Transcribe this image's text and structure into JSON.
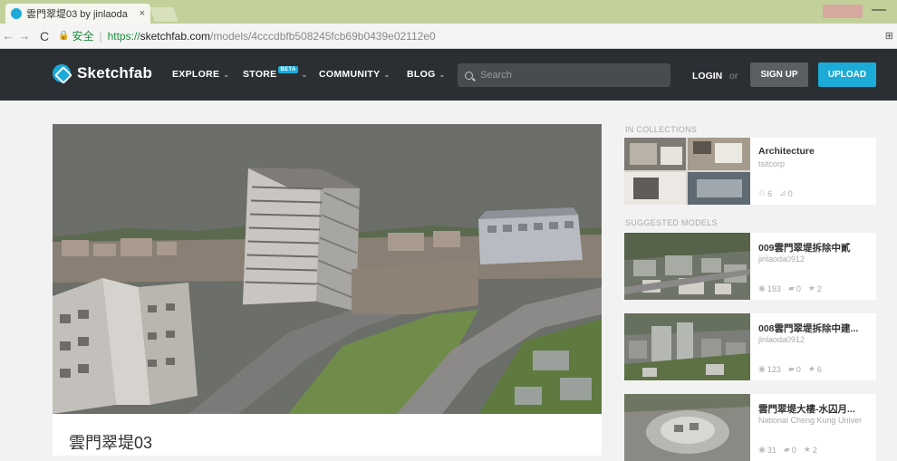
{
  "browser": {
    "tab_title": "雲門翠堤03 by jinlaoda",
    "tab_close": "×",
    "profile_badge": "",
    "minimize": "—",
    "url": {
      "secure_label": "安全",
      "scheme": "https://",
      "host": "sketchfab.com",
      "path": "/models/4cccdbfb508245fcb69b0439e02112e0"
    }
  },
  "header": {
    "logo_text": "Sketchfab",
    "nav": {
      "explore": "EXPLORE",
      "store": "STORE",
      "store_badge": "BETA",
      "community": "COMMUNITY",
      "blog": "BLOG"
    },
    "search_placeholder": "Search",
    "login": "LOGIN",
    "or": "or",
    "signup": "SIGN UP",
    "upload": "UPLOAD"
  },
  "model": {
    "title": "雲門翠堤03"
  },
  "sidebar": {
    "collections_label": "IN COLLECTIONS",
    "collection": {
      "title": "Architecture",
      "author": "tsitcorp",
      "likes": "6",
      "models": "0"
    },
    "suggested_label": "SUGGESTED MODELS",
    "suggested": [
      {
        "title": "009雲門翠堤拆除中貳",
        "author": "jinlaoda0912",
        "views": "193",
        "comments": "0",
        "likes": "2"
      },
      {
        "title": "008雲門翠堤拆除中建...",
        "author": "jinlaoda0912",
        "views": "123",
        "comments": "0",
        "likes": "6"
      },
      {
        "title": "雲門翠堤大樓-水囚月...",
        "author": "National Cheng Kung Univer",
        "views": "31",
        "comments": "0",
        "likes": "2"
      }
    ]
  },
  "colors": {
    "header_bg": "#2b2f33",
    "accent": "#1caad9",
    "page_bg": "#f2f2f2"
  }
}
